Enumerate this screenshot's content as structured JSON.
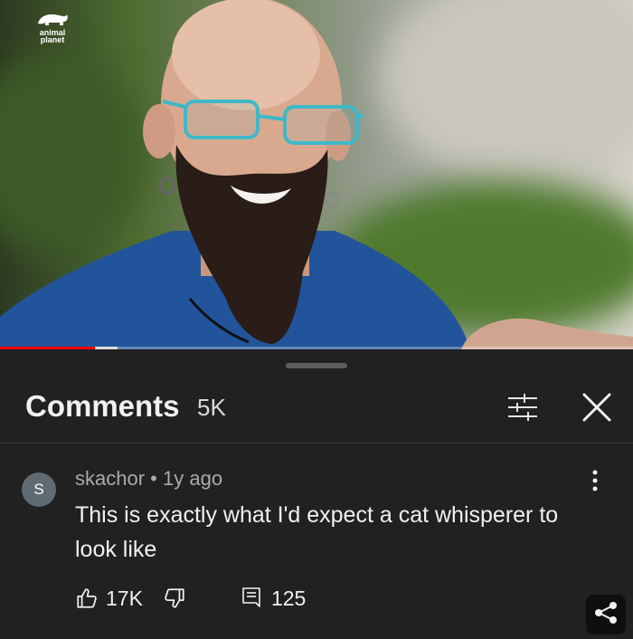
{
  "video": {
    "channel_logo_text": "animal planet",
    "progress_fraction": 0.15
  },
  "comments_panel": {
    "title": "Comments",
    "count": "5K"
  },
  "comment": {
    "avatar_letter": "S",
    "author": "skachor",
    "separator": "•",
    "time": "1y ago",
    "text": "This is exactly what I'd expect a cat whisperer to look like",
    "likes": "17K",
    "replies": "125"
  },
  "colors": {
    "background": "#212121",
    "progress_red": "#ff0000",
    "avatar": "#5f6b73"
  },
  "icons": [
    "animal-planet-logo",
    "filter-icon",
    "close-icon",
    "more-vert-icon",
    "thumb-up-icon",
    "thumb-down-icon",
    "reply-icon",
    "share-icon"
  ]
}
